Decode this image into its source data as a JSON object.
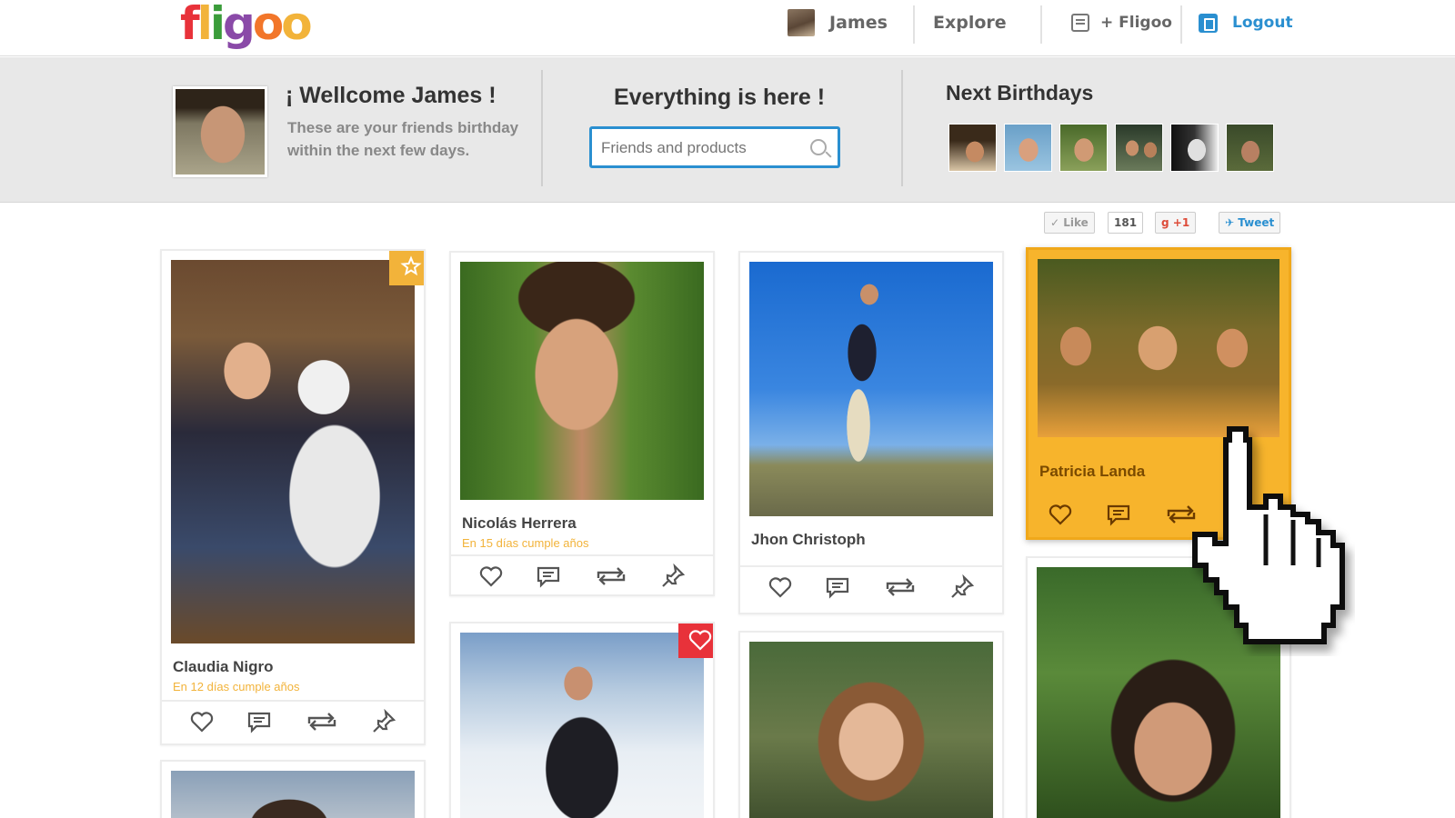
{
  "app": {
    "logo": "fligoo"
  },
  "logo_colors": [
    "#e8323a",
    "#f2b33a",
    "#3a9c3a",
    "#8a4aa8",
    "#f2762a",
    "#f2b33a"
  ],
  "nav": {
    "user": "James",
    "explore": "Explore",
    "add": "+ Fligoo",
    "logout": "Logout"
  },
  "welcome": {
    "title": "¡ Wellcome James !",
    "subtitle": "These are your friends birthday within the next few days."
  },
  "search": {
    "title": "Everything is here !",
    "placeholder": "Friends and products"
  },
  "birthdays": {
    "title": "Next Birthdays",
    "count": 6
  },
  "social": {
    "like": "Like",
    "like_count": "181",
    "gplus": "+1",
    "tweet": "Tweet"
  },
  "cards": [
    {
      "name": "Claudia Nigro",
      "bday": "En 12 días cumple años",
      "badge": "star-icon"
    },
    {
      "name": "Nicolás Herrera",
      "bday": "En 15 días cumple años"
    },
    {
      "name": "Jhon Christoph",
      "bday": ""
    },
    {
      "name": "Patricia Landa",
      "bday": "",
      "highlighted": true
    },
    {
      "name": "",
      "bday": "",
      "badge": "heart-icon"
    }
  ],
  "colors": {
    "accent": "#2a8fd0",
    "highlight": "#f7b42c",
    "bday_text": "#f2b33a",
    "heart_badge": "#e8323a"
  }
}
